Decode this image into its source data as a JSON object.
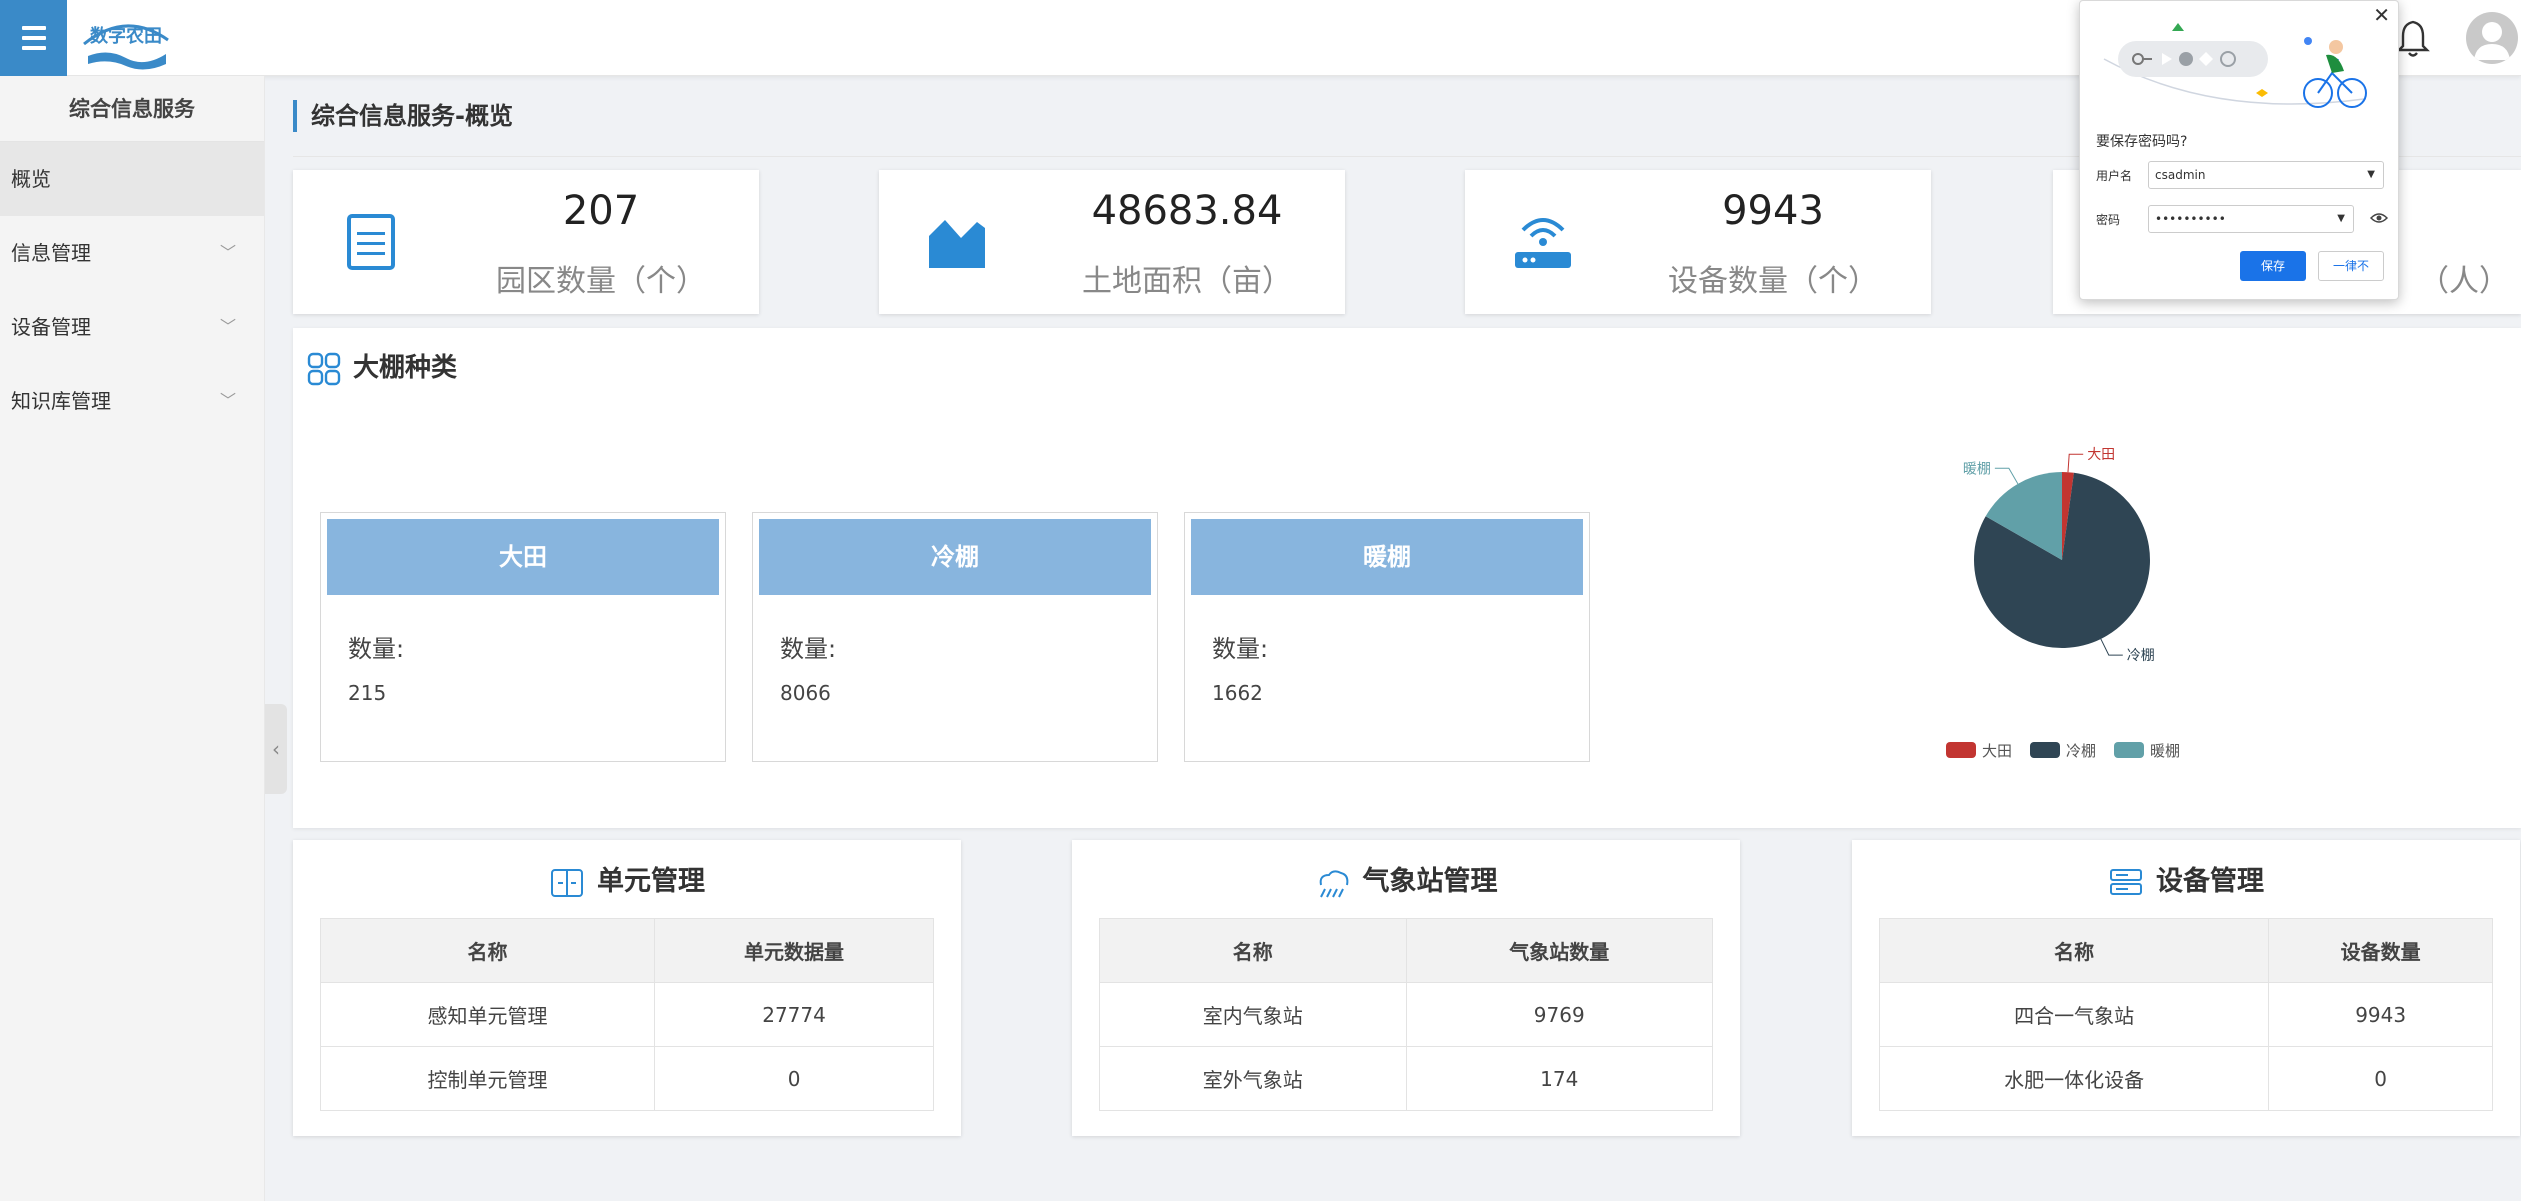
{
  "header": {
    "logo_text": "数字农田",
    "menu_icon": "hamburger-icon",
    "bell_icon": "bell-icon",
    "avatar_icon": "user-avatar-icon"
  },
  "sidebar": {
    "title": "综合信息服务",
    "items": [
      {
        "label": "概览",
        "active": true
      },
      {
        "label": "信息管理",
        "has_children": true
      },
      {
        "label": "设备管理",
        "has_children": true
      },
      {
        "label": "知识库管理",
        "has_children": true
      }
    ]
  },
  "page": {
    "title": "综合信息服务-概览"
  },
  "stats": [
    {
      "value": "207",
      "label": "园区数量（个）",
      "icon": "server-list-icon"
    },
    {
      "value": "48683.84",
      "label": "土地面积（亩）",
      "icon": "area-chart-icon"
    },
    {
      "value": "9943",
      "label": "设备数量（个）",
      "icon": "router-wifi-icon"
    },
    {
      "value": "",
      "label": "（人）",
      "icon": "people-icon"
    }
  ],
  "greenhouse": {
    "title": "大棚种类",
    "qty_label": "数量:",
    "cards": [
      {
        "name": "大田",
        "count": "215"
      },
      {
        "name": "冷棚",
        "count": "8066"
      },
      {
        "name": "暖棚",
        "count": "1662"
      }
    ]
  },
  "chart_data": {
    "type": "pie",
    "categories": [
      "大田",
      "冷棚",
      "暖棚"
    ],
    "values": [
      215,
      8066,
      1662
    ],
    "colors": [
      "#c23531",
      "#2f4554",
      "#61a0a8"
    ],
    "legend": "bottom"
  },
  "mgmt": [
    {
      "title": "单元管理",
      "icon": "unit-icon",
      "headers": [
        "名称",
        "单元数据量"
      ],
      "rows": [
        [
          "感知单元管理",
          "27774"
        ],
        [
          "控制单元管理",
          "0"
        ]
      ]
    },
    {
      "title": "气象站管理",
      "icon": "weather-station-icon",
      "headers": [
        "名称",
        "气象站数量"
      ],
      "rows": [
        [
          "室内气象站",
          "9769"
        ],
        [
          "室外气象站",
          "174"
        ]
      ]
    },
    {
      "title": "设备管理",
      "icon": "device-icon",
      "headers": [
        "名称",
        "设备数量"
      ],
      "rows": [
        [
          "四合一气象站",
          "9943"
        ],
        [
          "水肥一体化设备",
          "0"
        ]
      ]
    }
  ],
  "password_popup": {
    "question": "要保存密码吗?",
    "username_label": "用户名",
    "username_value": "csadmin",
    "password_label": "密码",
    "password_value": "••••••••••",
    "save_label": "保存",
    "never_label": "一律不",
    "close": "✕"
  }
}
